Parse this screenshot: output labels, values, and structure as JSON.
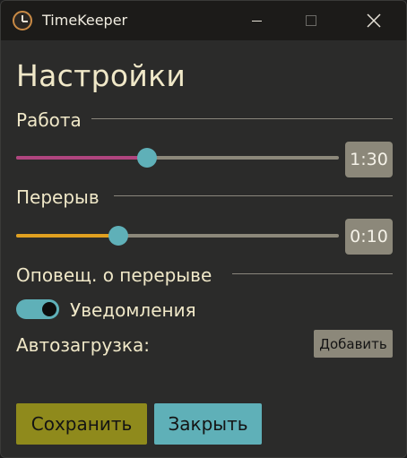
{
  "titlebar": {
    "app_icon": "clock-icon",
    "title": "TimeKeeper",
    "minimize_icon": "minimize-icon",
    "maximize_icon": "maximize-icon",
    "close_icon": "close-icon"
  },
  "settings": {
    "heading": "Настройки",
    "work": {
      "label": "Работа",
      "value": "1:30",
      "slider_fraction": 0.405,
      "fill_color": "#b0457f"
    },
    "break": {
      "label": "Перерыв",
      "value": "0:10",
      "slider_fraction": 0.317,
      "fill_color": "#e0a020"
    },
    "break_notification": {
      "label": "Оповещ. о перерыве",
      "toggle_label": "Уведомления",
      "enabled": true
    },
    "autostart": {
      "label": "Автозагрузка:",
      "add_button": "Добавить"
    }
  },
  "actions": {
    "save": "Сохранить",
    "close": "Закрыть"
  },
  "colors": {
    "accent_teal": "#5fb0b8",
    "save_olive": "#8f8a1c",
    "text_cream": "#f0e8c8",
    "background": "#2b2b2a"
  }
}
